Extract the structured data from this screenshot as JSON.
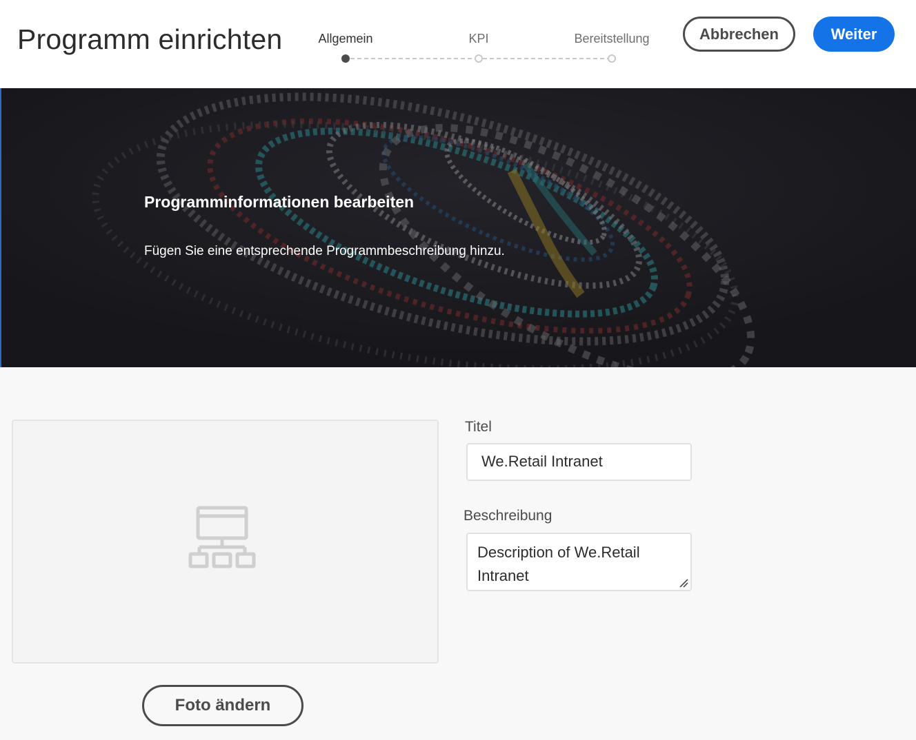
{
  "header": {
    "title": "Programm einrichten",
    "steps": [
      {
        "label": "Allgemein",
        "state": "active"
      },
      {
        "label": "KPI",
        "state": "inactive"
      },
      {
        "label": "Bereitstellung",
        "state": "inactive"
      }
    ],
    "cancel_label": "Abbrechen",
    "next_label": "Weiter"
  },
  "hero": {
    "title": "Programminformationen bearbeiten",
    "description": "Fügen Sie eine entsprechende Programmbeschreibung hinzu."
  },
  "form": {
    "thumbnail_icon": "site-structure-icon",
    "change_photo_label": "Foto ändern",
    "title_label": "Titel",
    "title_value": "We.Retail Intranet",
    "description_label": "Beschreibung",
    "description_value": "Description of We.Retail Intranet"
  },
  "colors": {
    "accent": "#1473e6",
    "hero_background": "#1e1d22",
    "page_background": "#f8f8f8"
  }
}
